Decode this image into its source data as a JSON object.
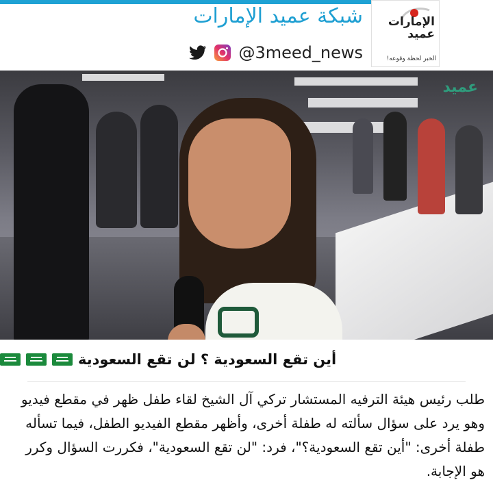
{
  "header": {
    "site_title": "شبكة عميد الإمارات",
    "handle": "@3meed_news",
    "icons": [
      "twitter-icon",
      "instagram-icon"
    ],
    "accent_color": "#1e9fd2",
    "logo": {
      "name_line1": "الإمارات",
      "name_line2": "عميد",
      "tagline": "الخبر لحظة وقوعه!"
    }
  },
  "video": {
    "watermark": "عميد"
  },
  "article": {
    "headline": "أين تقع السعودية ؟ لن تقع السعودية",
    "flag_icons": [
      "saudi-flag-icon",
      "saudi-flag-icon",
      "saudi-flag-icon"
    ],
    "body": "طلب رئيس هيئة الترفيه المستشار تركي آل الشيخ لقاء طفل ظهر في مقطع فيديو وهو يرد على سؤال سألته له طفلة أخرى، وأظهر مقطع الفيديو الطفل، فيما تسأله طفلة أخرى: \"أين تقع السعودية؟\"، فرد: \"لن تقع السعودية\"، فكررت السؤال وكرر هو الإجابة."
  }
}
